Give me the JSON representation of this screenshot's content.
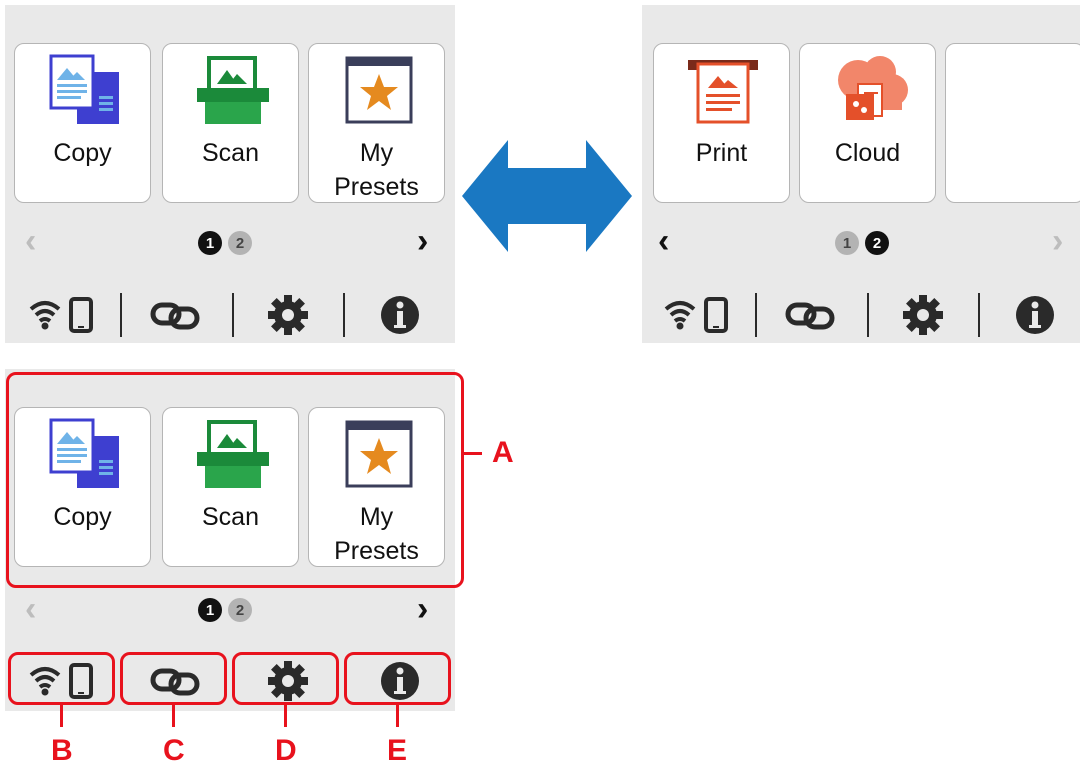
{
  "colors": {
    "accent_red": "#e8121d",
    "arrow_blue": "#1a78c2",
    "panel_bg": "#e9e9e9"
  },
  "screen1": {
    "tiles": [
      {
        "label": "Copy",
        "icon": "copy-icon"
      },
      {
        "label": "Scan",
        "icon": "scan-icon"
      },
      {
        "label_line1": "My",
        "label_line2": "Presets",
        "icon": "star-icon"
      }
    ],
    "pager": {
      "current": "1",
      "other": "2"
    },
    "bottom_icons": [
      "wifi-phone-icon",
      "link-icon",
      "gear-icon",
      "info-icon"
    ]
  },
  "screen2": {
    "tiles": [
      {
        "label": "Print",
        "icon": "print-icon"
      },
      {
        "label": "Cloud",
        "icon": "cloud-icon"
      },
      {
        "label": "",
        "icon": ""
      }
    ],
    "pager": {
      "other": "1",
      "current": "2"
    },
    "bottom_icons": [
      "wifi-phone-icon",
      "link-icon",
      "gear-icon",
      "info-icon"
    ]
  },
  "screen3": {
    "tiles": [
      {
        "label": "Copy",
        "icon": "copy-icon"
      },
      {
        "label": "Scan",
        "icon": "scan-icon"
      },
      {
        "label_line1": "My",
        "label_line2": "Presets",
        "icon": "star-icon"
      }
    ],
    "pager": {
      "current": "1",
      "other": "2"
    },
    "bottom_icons": [
      "wifi-phone-icon",
      "link-icon",
      "gear-icon",
      "info-icon"
    ]
  },
  "callouts": {
    "a": "A",
    "b": "B",
    "c": "C",
    "d": "D",
    "e": "E"
  }
}
